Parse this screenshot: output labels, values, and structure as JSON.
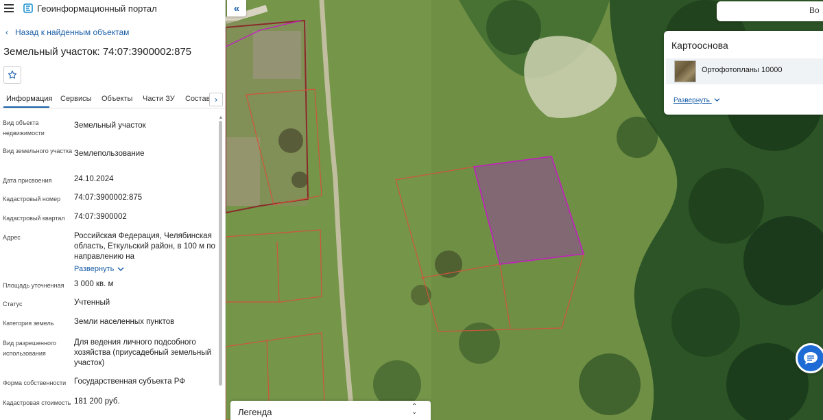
{
  "header": {
    "app_title": "Геоинформационный портал"
  },
  "nav": {
    "back_label": "Назад к найденным объектам"
  },
  "object": {
    "title": "Земельный участок: 74:07:3900002:875"
  },
  "tabs": [
    {
      "label": "Информация"
    },
    {
      "label": "Сервисы"
    },
    {
      "label": "Объекты"
    },
    {
      "label": "Части ЗУ"
    },
    {
      "label": "Состав"
    }
  ],
  "info": {
    "rows": [
      {
        "label": "Вид объекта недвижимости",
        "value": "Земельный участок"
      },
      {
        "label": "Вид земельного участка",
        "value": "Землепользование"
      },
      {
        "label": "Дата присвоения",
        "value": "24.10.2024"
      },
      {
        "label": "Кадастровый номер",
        "value": "74:07:3900002:875"
      },
      {
        "label": "Кадастровый квартал",
        "value": "74:07:3900002"
      },
      {
        "label": "Адрес",
        "value": "Российская Федерация, Челябинская область, Еткульский район, в 100 м по направлению на"
      },
      {
        "label": "Площадь уточненная",
        "value": "3 000 кв. м"
      },
      {
        "label": "Статус",
        "value": "Учтенный"
      },
      {
        "label": "Категория земель",
        "value": "Земли населенных пунктов"
      },
      {
        "label": "Вид разрешенного использования",
        "value": "Для ведения личного подсобного хозяйства (приусадебный земельный участок)"
      },
      {
        "label": "Форма собственности",
        "value": "Государственная субъекта РФ"
      },
      {
        "label": "Кадастровая стоимость",
        "value": "181 200 руб."
      }
    ],
    "expand_label": "Развернуть"
  },
  "search": {
    "text": "Во"
  },
  "basemap": {
    "header": "Картооснова",
    "option_label": "Ортофотопланы 10000",
    "expand_label": "Развернуть"
  },
  "legend": {
    "title": "Легенда"
  },
  "colors": {
    "accent": "#1a5ea8",
    "parcel_selected": "#c21ec2",
    "parcel_border": "#d0553a",
    "chat_button": "#1e6bd6"
  },
  "icons": {
    "menu": "hamburger-icon",
    "logo": "portal-logo-icon",
    "back": "chevron-left-icon",
    "favorite": "star-icon",
    "tabs_next": "chevron-right-icon",
    "collapse": "double-chevron-left-icon",
    "expand": "chevron-down-icon",
    "sort": "up-down-icon",
    "chat": "chat-icon"
  }
}
